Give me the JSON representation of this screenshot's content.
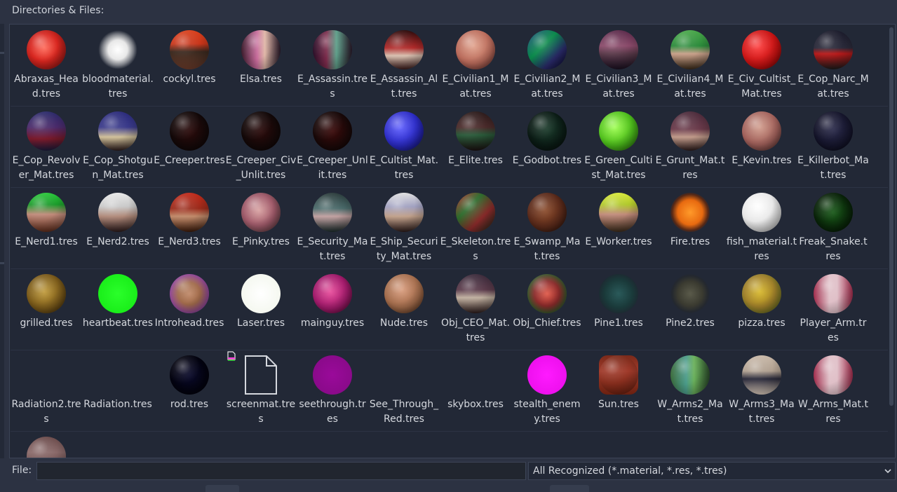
{
  "header": {
    "title": "Directories & Files:"
  },
  "footer": {
    "file_label": "File:",
    "file_value": "",
    "filter_selected": "All Recognized (*.material, *.res, *.tres)"
  },
  "rows": [
    [
      {
        "name": "Abraxas_Head.tres",
        "thumb": "abraxas"
      },
      {
        "name": "bloodmaterial.tres",
        "thumb": "blood"
      },
      {
        "name": "cockyl.tres",
        "thumb": "cockyl"
      },
      {
        "name": "Elsa.tres",
        "thumb": "elsa"
      },
      {
        "name": "E_Assassin.tres",
        "thumb": "assassin"
      },
      {
        "name": "E_Assassin_Alt.tres",
        "thumb": "assassin_alt"
      },
      {
        "name": "E_Civilian1_Mat.tres",
        "thumb": "civ1"
      },
      {
        "name": "E_Civilian2_Mat.tres",
        "thumb": "civ2"
      },
      {
        "name": "E_Civilian3_Mat.tres",
        "thumb": "civ3"
      },
      {
        "name": "E_Civilian4_Mat.tres",
        "thumb": "civ4"
      },
      {
        "name": "E_Civ_Cultist_Mat.tres",
        "thumb": "civcult"
      },
      {
        "name": "E_Cop_Narc_Mat.tres",
        "thumb": "copnarc"
      }
    ],
    [
      {
        "name": "E_Cop_Revolver_Mat.tres",
        "thumb": "coprev"
      },
      {
        "name": "E_Cop_Shotgun_Mat.tres",
        "thumb": "copshot"
      },
      {
        "name": "E_Creeper.tres",
        "thumb": "creeper"
      },
      {
        "name": "E_Creeper_Civ_Unlit.tres",
        "thumb": "creeper"
      },
      {
        "name": "E_Creeper_Unlit.tres",
        "thumb": "creeper2"
      },
      {
        "name": "E_Cultist_Mat.tres",
        "thumb": "cultist"
      },
      {
        "name": "E_Elite.tres",
        "thumb": "elite"
      },
      {
        "name": "E_Godbot.tres",
        "thumb": "godbot"
      },
      {
        "name": "E_Green_Cultist_Mat.tres",
        "thumb": "greencult"
      },
      {
        "name": "E_Grunt_Mat.tres",
        "thumb": "grunt"
      },
      {
        "name": "E_Kevin.tres",
        "thumb": "kevin"
      },
      {
        "name": "E_Killerbot_Mat.tres",
        "thumb": "killerbot"
      }
    ],
    [
      {
        "name": "E_Nerd1.tres",
        "thumb": "nerd1"
      },
      {
        "name": "E_Nerd2.tres",
        "thumb": "nerd2"
      },
      {
        "name": "E_Nerd3.tres",
        "thumb": "nerd3"
      },
      {
        "name": "E_Pinky.tres",
        "thumb": "pinky"
      },
      {
        "name": "E_Security_Mat.tres",
        "thumb": "security"
      },
      {
        "name": "E_Ship_Security_Mat.tres",
        "thumb": "shipsec"
      },
      {
        "name": "E_Skeleton.tres",
        "thumb": "skeleton"
      },
      {
        "name": "E_Swamp_Mat.tres",
        "thumb": "swamp"
      },
      {
        "name": "E_Worker.tres",
        "thumb": "worker"
      },
      {
        "name": "Fire.tres",
        "thumb": "fire"
      },
      {
        "name": "fish_material.tres",
        "thumb": "fish"
      },
      {
        "name": "Freak_Snake.tres",
        "thumb": "snake"
      }
    ],
    [
      {
        "name": "grilled.tres",
        "thumb": "grilled"
      },
      {
        "name": "heartbeat.tres",
        "thumb": "heartbeat"
      },
      {
        "name": "Introhead.tres",
        "thumb": "introhead"
      },
      {
        "name": "Laser.tres",
        "thumb": "laser"
      },
      {
        "name": "mainguy.tres",
        "thumb": "mainguy"
      },
      {
        "name": "Nude.tres",
        "thumb": "nude"
      },
      {
        "name": "Obj_CEO_Mat.tres",
        "thumb": "ceo"
      },
      {
        "name": "Obj_Chief.tres",
        "thumb": "chief"
      },
      {
        "name": "Pine1.tres",
        "thumb": "pine1"
      },
      {
        "name": "Pine2.tres",
        "thumb": "pine2"
      },
      {
        "name": "pizza.tres",
        "thumb": "pizza"
      },
      {
        "name": "Player_Arm.tres",
        "thumb": "playerarm"
      }
    ],
    [
      {
        "name": "Radiation2.tres",
        "thumb": "none"
      },
      {
        "name": "Radiation.tres",
        "thumb": "none"
      },
      {
        "name": "rod.tres",
        "thumb": "rod"
      },
      {
        "name": "screenmat.tres",
        "thumb": "file"
      },
      {
        "name": "seethrough.tres",
        "thumb": "seethrough"
      },
      {
        "name": "See_Through_Red.tres",
        "thumb": "none"
      },
      {
        "name": "skybox.tres",
        "thumb": "none"
      },
      {
        "name": "stealth_enemy.tres",
        "thumb": "stealth"
      },
      {
        "name": "Sun.tres",
        "thumb": "sun"
      },
      {
        "name": "W_Arms2_Mat.tres",
        "thumb": "arms2"
      },
      {
        "name": "W_Arms3_Mat.tres",
        "thumb": "arms3"
      },
      {
        "name": "W_Arms_Mat.tres",
        "thumb": "arms"
      }
    ],
    [
      {
        "name": "",
        "thumb": "partial"
      }
    ]
  ],
  "colors": {
    "background": "#2c3242",
    "panel": "#222836",
    "border": "#3c4456",
    "text": "#d5d8de"
  }
}
